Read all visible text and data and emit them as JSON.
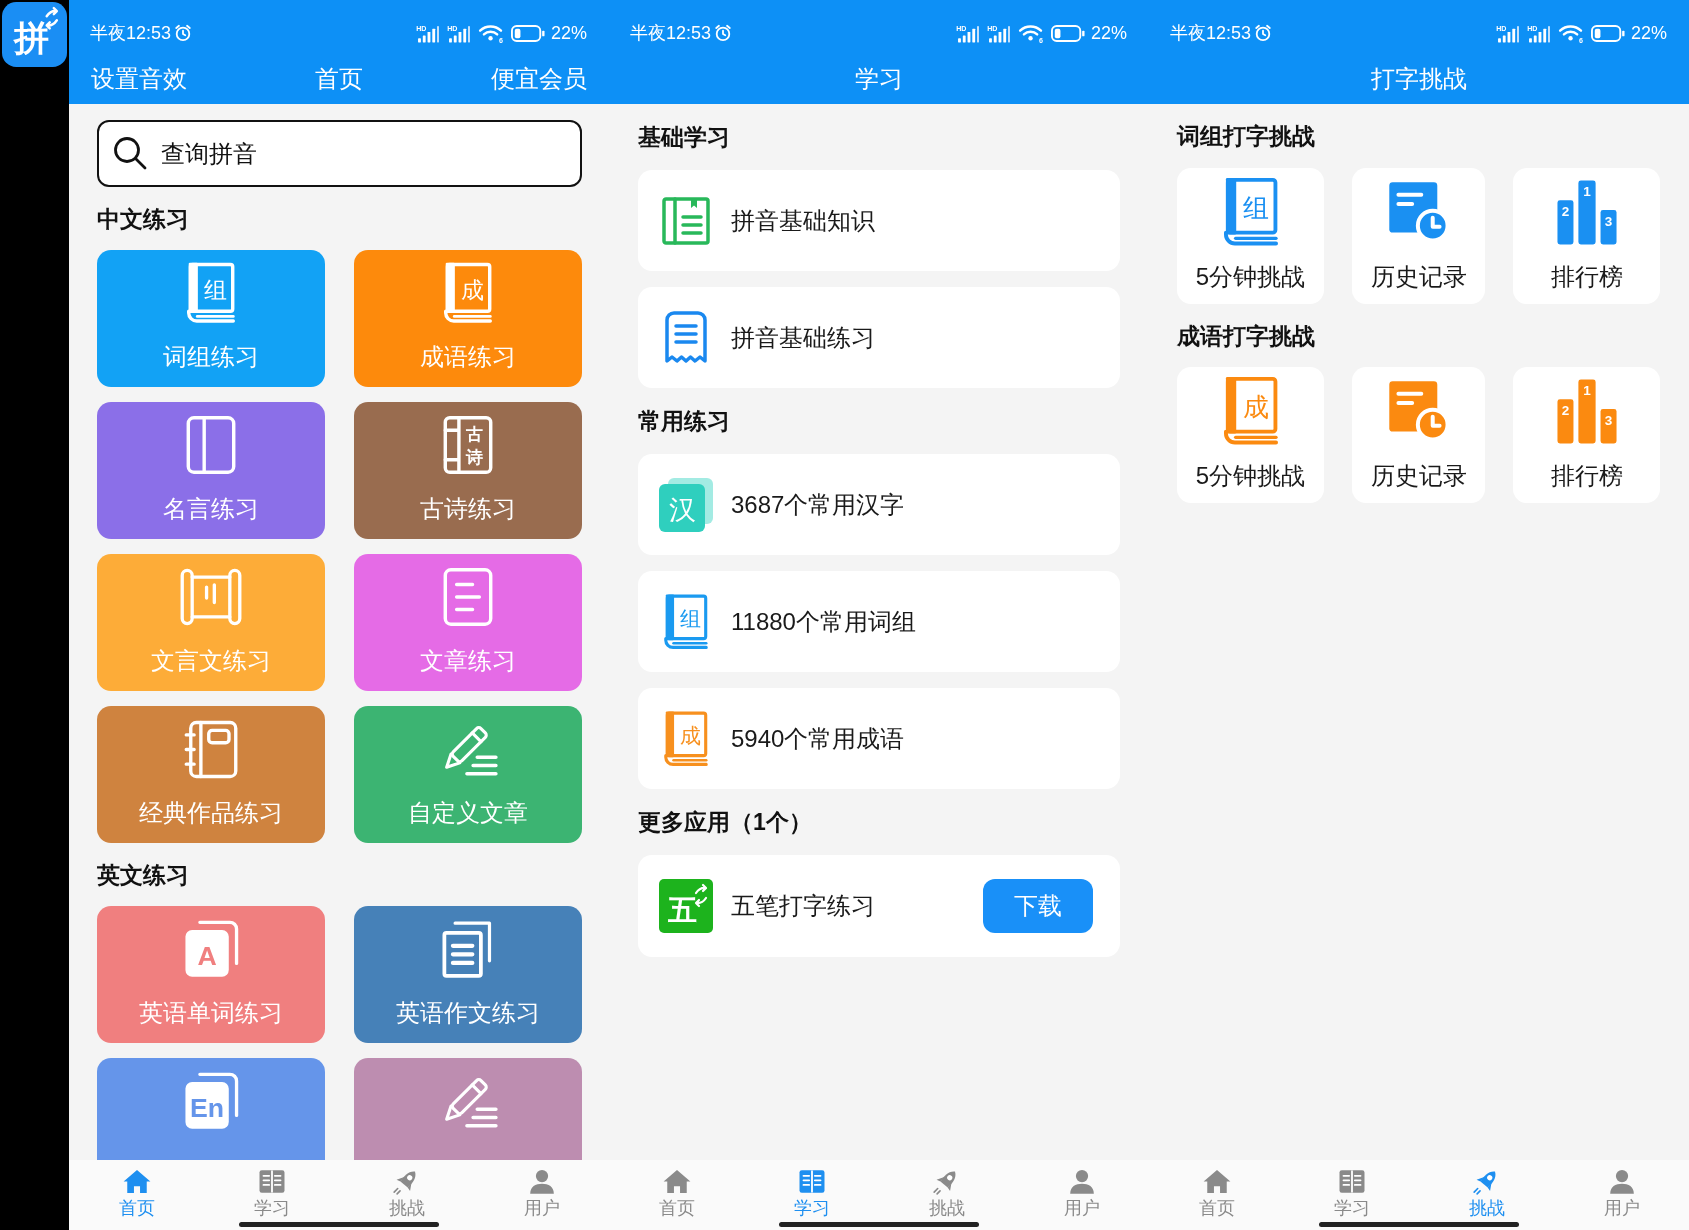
{
  "app_icon": {
    "glyph": "拼"
  },
  "screens": [
    {
      "kind": "home",
      "status_bar": {
        "time": "半夜12:53",
        "signal_labels": [
          "HD",
          "HD"
        ],
        "wifi_label": "6",
        "battery": "22%"
      },
      "header": {
        "left_action": "设置音效",
        "title": "首页",
        "right_action": "便宜会员"
      },
      "search": {
        "placeholder": "查询拼音"
      },
      "sections": [
        {
          "heading": "中文练习",
          "rows": [
            [
              {
                "label": "词组练习",
                "color": "#12a2f5",
                "icon_text": "组"
              },
              {
                "label": "成语练习",
                "color": "#fd8a0c",
                "icon_text": "成"
              }
            ],
            [
              {
                "label": "名言练习",
                "color": "#8b6fe8"
              },
              {
                "label": "古诗练习",
                "color": "#996c4f",
                "icon_text": "古诗"
              }
            ],
            [
              {
                "label": "文言文练习",
                "color": "#fdac38"
              },
              {
                "label": "文章练习",
                "color": "#e56be6"
              }
            ],
            [
              {
                "label": "经典作品练习",
                "color": "#cf833f"
              },
              {
                "label": "自定义文章",
                "color": "#3cb472"
              }
            ]
          ]
        },
        {
          "heading": "英文练习",
          "rows": [
            [
              {
                "label": "英语单词练习",
                "color": "#f07f7f",
                "icon_text": "A"
              },
              {
                "label": "英语作文练习",
                "color": "#4681b8"
              }
            ],
            [
              {
                "color": "#6595ea",
                "icon_text": "En"
              },
              {
                "color": "#bd8db0"
              }
            ]
          ]
        }
      ],
      "nav": [
        {
          "label": "首页",
          "selected": true
        },
        {
          "label": "学习",
          "selected": false
        },
        {
          "label": "挑战",
          "selected": false
        },
        {
          "label": "用户",
          "selected": false
        }
      ]
    },
    {
      "kind": "study",
      "status_bar": {
        "time": "半夜12:53",
        "signal_labels": [
          "HD",
          "HD"
        ],
        "wifi_label": "6",
        "battery": "22%"
      },
      "header": {
        "title": "学习"
      },
      "sections": [
        {
          "heading": "基础学习",
          "items": [
            {
              "label": "拼音基础知识"
            },
            {
              "label": "拼音基础练习"
            }
          ]
        },
        {
          "heading": "常用练习",
          "items": [
            {
              "label": "3687个常用汉字",
              "icon_text": "汉"
            },
            {
              "label": "11880个常用词组",
              "icon_text": "组"
            },
            {
              "label": "5940个常用成语",
              "icon_text": "成"
            }
          ]
        },
        {
          "heading": "更多应用（1个）",
          "items": [
            {
              "label": "五笔打字练习",
              "icon_text": "五",
              "button": "下载"
            }
          ]
        }
      ],
      "nav": [
        {
          "label": "首页",
          "selected": false
        },
        {
          "label": "学习",
          "selected": true
        },
        {
          "label": "挑战",
          "selected": false
        },
        {
          "label": "用户",
          "selected": false
        }
      ]
    },
    {
      "kind": "challenge",
      "status_bar": {
        "time": "半夜12:53",
        "signal_labels": [
          "HD",
          "HD"
        ],
        "wifi_label": "6",
        "battery": "22%"
      },
      "header": {
        "title": "打字挑战"
      },
      "sections": [
        {
          "heading": "词组打字挑战",
          "color": "#1a90f2",
          "cards": [
            {
              "label": "5分钟挑战",
              "icon_text": "组"
            },
            {
              "label": "历史记录"
            },
            {
              "label": "排行榜",
              "icon_numbers": [
                "2",
                "1",
                "3"
              ]
            }
          ]
        },
        {
          "heading": "成语打字挑战",
          "color": "#fb8a10",
          "cards": [
            {
              "label": "5分钟挑战",
              "icon_text": "成"
            },
            {
              "label": "历史记录"
            },
            {
              "label": "排行榜",
              "icon_numbers": [
                "2",
                "1",
                "3"
              ]
            }
          ]
        }
      ],
      "nav": [
        {
          "label": "首页",
          "selected": false
        },
        {
          "label": "学习",
          "selected": false
        },
        {
          "label": "挑战",
          "selected": true
        },
        {
          "label": "用户",
          "selected": false
        }
      ]
    }
  ]
}
